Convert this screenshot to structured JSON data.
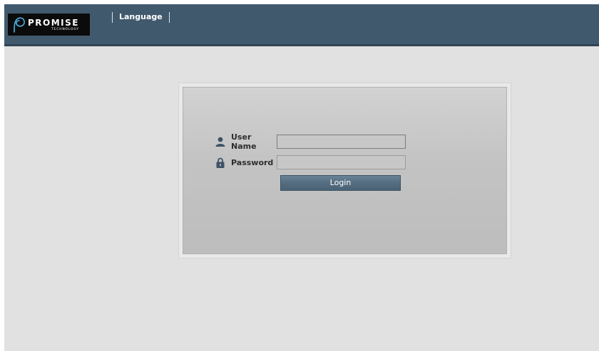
{
  "brand": {
    "name": "PROMISE",
    "subtitle": "TECHNOLOGY",
    "logo_icon": "promise-swirl-logo"
  },
  "nav": {
    "language_label": "Language"
  },
  "login": {
    "username_label": "User Name",
    "username_icon": "user-icon",
    "username_value": "",
    "password_label": "Password",
    "password_icon": "lock-icon",
    "password_value": "",
    "submit_label": "Login"
  },
  "colors": {
    "header": "#41596d",
    "page_background": "#e1e1e1",
    "panel": "#c3c3c3",
    "button": "#556d81",
    "icon": "#3d5366"
  }
}
